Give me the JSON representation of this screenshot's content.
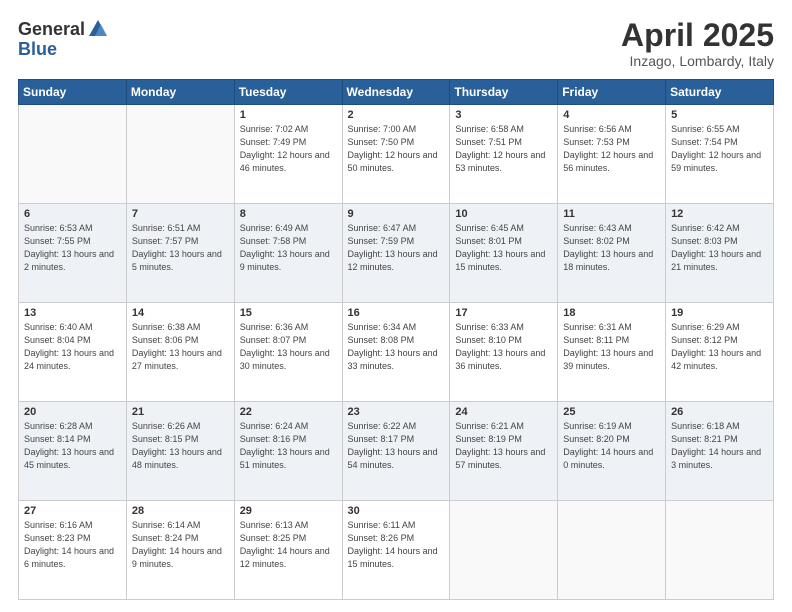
{
  "header": {
    "logo_general": "General",
    "logo_blue": "Blue",
    "title": "April 2025",
    "location": "Inzago, Lombardy, Italy"
  },
  "weekdays": [
    "Sunday",
    "Monday",
    "Tuesday",
    "Wednesday",
    "Thursday",
    "Friday",
    "Saturday"
  ],
  "weeks": [
    [
      {
        "day": "",
        "info": ""
      },
      {
        "day": "",
        "info": ""
      },
      {
        "day": "1",
        "info": "Sunrise: 7:02 AM\nSunset: 7:49 PM\nDaylight: 12 hours and 46 minutes."
      },
      {
        "day": "2",
        "info": "Sunrise: 7:00 AM\nSunset: 7:50 PM\nDaylight: 12 hours and 50 minutes."
      },
      {
        "day": "3",
        "info": "Sunrise: 6:58 AM\nSunset: 7:51 PM\nDaylight: 12 hours and 53 minutes."
      },
      {
        "day": "4",
        "info": "Sunrise: 6:56 AM\nSunset: 7:53 PM\nDaylight: 12 hours and 56 minutes."
      },
      {
        "day": "5",
        "info": "Sunrise: 6:55 AM\nSunset: 7:54 PM\nDaylight: 12 hours and 59 minutes."
      }
    ],
    [
      {
        "day": "6",
        "info": "Sunrise: 6:53 AM\nSunset: 7:55 PM\nDaylight: 13 hours and 2 minutes."
      },
      {
        "day": "7",
        "info": "Sunrise: 6:51 AM\nSunset: 7:57 PM\nDaylight: 13 hours and 5 minutes."
      },
      {
        "day": "8",
        "info": "Sunrise: 6:49 AM\nSunset: 7:58 PM\nDaylight: 13 hours and 9 minutes."
      },
      {
        "day": "9",
        "info": "Sunrise: 6:47 AM\nSunset: 7:59 PM\nDaylight: 13 hours and 12 minutes."
      },
      {
        "day": "10",
        "info": "Sunrise: 6:45 AM\nSunset: 8:01 PM\nDaylight: 13 hours and 15 minutes."
      },
      {
        "day": "11",
        "info": "Sunrise: 6:43 AM\nSunset: 8:02 PM\nDaylight: 13 hours and 18 minutes."
      },
      {
        "day": "12",
        "info": "Sunrise: 6:42 AM\nSunset: 8:03 PM\nDaylight: 13 hours and 21 minutes."
      }
    ],
    [
      {
        "day": "13",
        "info": "Sunrise: 6:40 AM\nSunset: 8:04 PM\nDaylight: 13 hours and 24 minutes."
      },
      {
        "day": "14",
        "info": "Sunrise: 6:38 AM\nSunset: 8:06 PM\nDaylight: 13 hours and 27 minutes."
      },
      {
        "day": "15",
        "info": "Sunrise: 6:36 AM\nSunset: 8:07 PM\nDaylight: 13 hours and 30 minutes."
      },
      {
        "day": "16",
        "info": "Sunrise: 6:34 AM\nSunset: 8:08 PM\nDaylight: 13 hours and 33 minutes."
      },
      {
        "day": "17",
        "info": "Sunrise: 6:33 AM\nSunset: 8:10 PM\nDaylight: 13 hours and 36 minutes."
      },
      {
        "day": "18",
        "info": "Sunrise: 6:31 AM\nSunset: 8:11 PM\nDaylight: 13 hours and 39 minutes."
      },
      {
        "day": "19",
        "info": "Sunrise: 6:29 AM\nSunset: 8:12 PM\nDaylight: 13 hours and 42 minutes."
      }
    ],
    [
      {
        "day": "20",
        "info": "Sunrise: 6:28 AM\nSunset: 8:14 PM\nDaylight: 13 hours and 45 minutes."
      },
      {
        "day": "21",
        "info": "Sunrise: 6:26 AM\nSunset: 8:15 PM\nDaylight: 13 hours and 48 minutes."
      },
      {
        "day": "22",
        "info": "Sunrise: 6:24 AM\nSunset: 8:16 PM\nDaylight: 13 hours and 51 minutes."
      },
      {
        "day": "23",
        "info": "Sunrise: 6:22 AM\nSunset: 8:17 PM\nDaylight: 13 hours and 54 minutes."
      },
      {
        "day": "24",
        "info": "Sunrise: 6:21 AM\nSunset: 8:19 PM\nDaylight: 13 hours and 57 minutes."
      },
      {
        "day": "25",
        "info": "Sunrise: 6:19 AM\nSunset: 8:20 PM\nDaylight: 14 hours and 0 minutes."
      },
      {
        "day": "26",
        "info": "Sunrise: 6:18 AM\nSunset: 8:21 PM\nDaylight: 14 hours and 3 minutes."
      }
    ],
    [
      {
        "day": "27",
        "info": "Sunrise: 6:16 AM\nSunset: 8:23 PM\nDaylight: 14 hours and 6 minutes."
      },
      {
        "day": "28",
        "info": "Sunrise: 6:14 AM\nSunset: 8:24 PM\nDaylight: 14 hours and 9 minutes."
      },
      {
        "day": "29",
        "info": "Sunrise: 6:13 AM\nSunset: 8:25 PM\nDaylight: 14 hours and 12 minutes."
      },
      {
        "day": "30",
        "info": "Sunrise: 6:11 AM\nSunset: 8:26 PM\nDaylight: 14 hours and 15 minutes."
      },
      {
        "day": "",
        "info": ""
      },
      {
        "day": "",
        "info": ""
      },
      {
        "day": "",
        "info": ""
      }
    ]
  ]
}
